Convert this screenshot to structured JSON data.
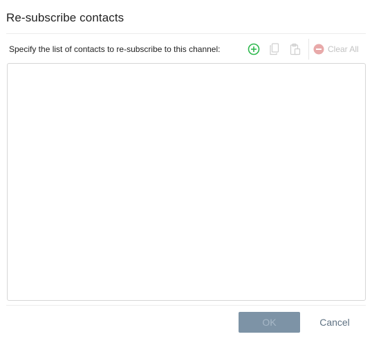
{
  "dialog": {
    "title": "Re-subscribe contacts",
    "instruction": "Specify the list of contacts to re-subscribe to this channel:"
  },
  "toolbar": {
    "add_icon": "plus-circle-icon",
    "copy_icon": "copy-icon",
    "paste_icon": "paste-icon",
    "clear_all_icon": "minus-circle-icon",
    "clear_all_label": "Clear All"
  },
  "contacts": {
    "items": []
  },
  "footer": {
    "ok_label": "OK",
    "cancel_label": "Cancel"
  },
  "colors": {
    "add_green": "#2db84d",
    "disabled_gray": "#c9c9c9",
    "ok_button_bg": "#7d93a6",
    "cancel_text": "#5f7283"
  }
}
